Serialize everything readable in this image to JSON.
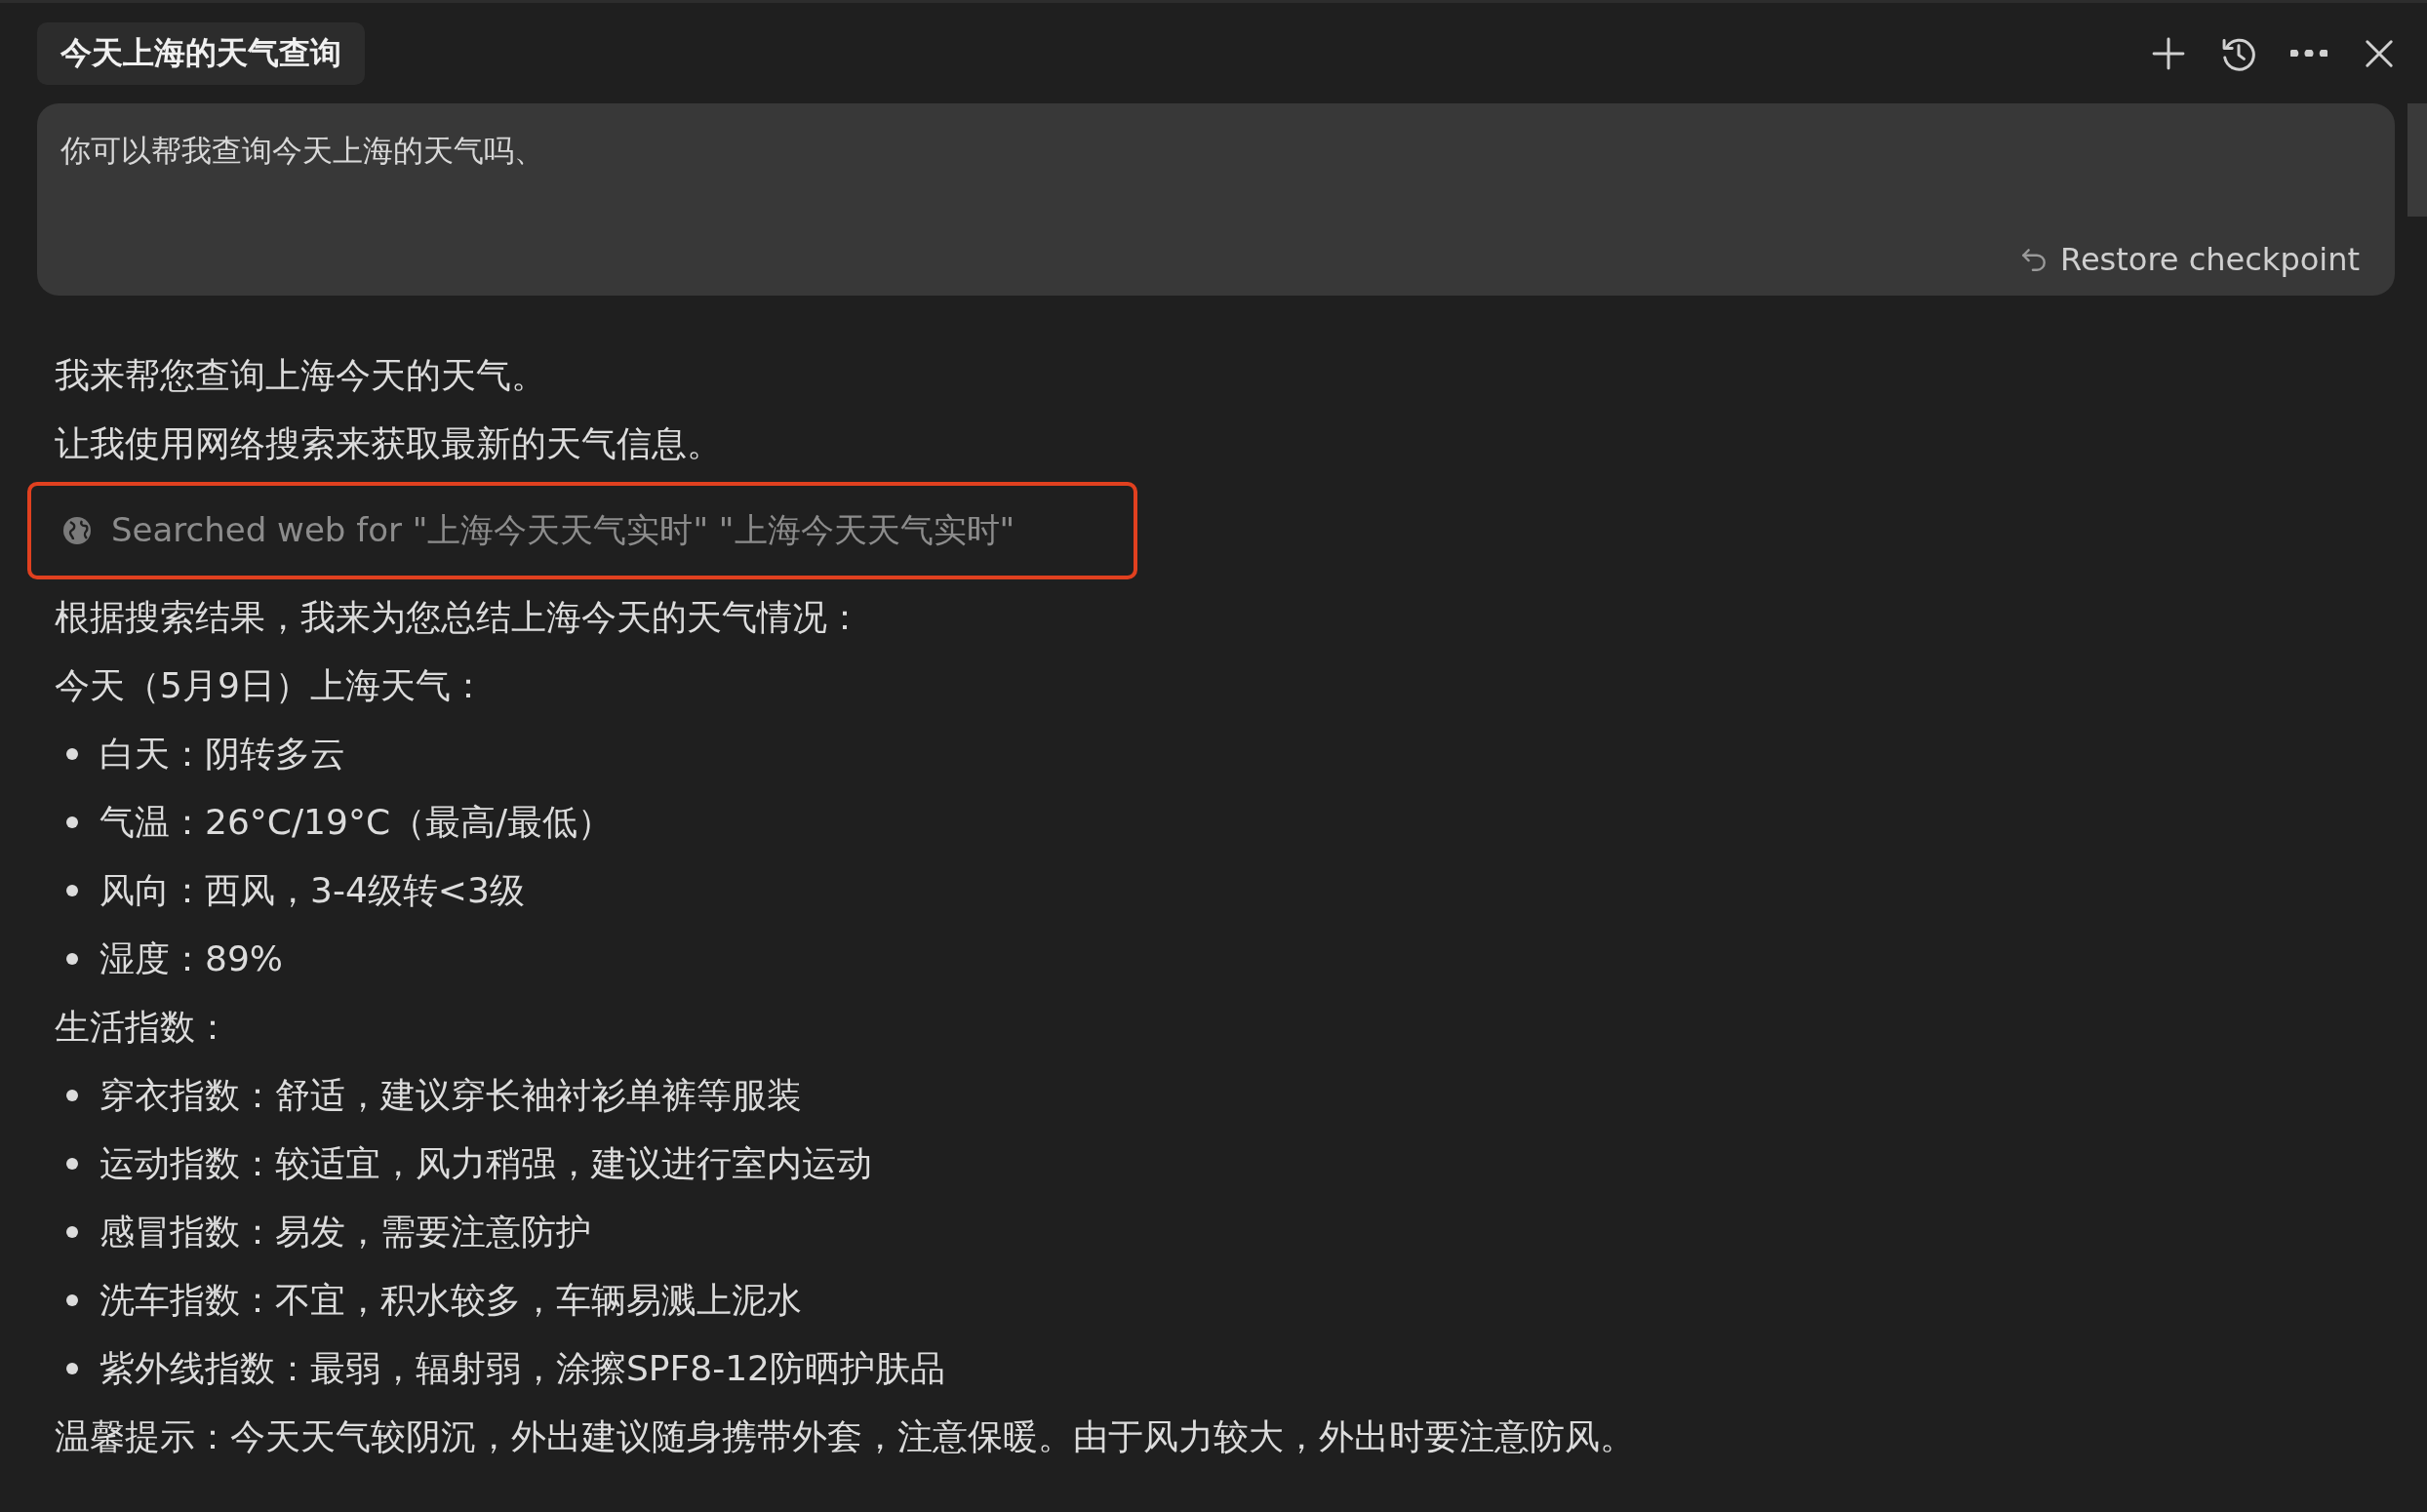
{
  "tab": {
    "title": "今天上海的天气查询"
  },
  "toolbar": [
    {
      "kind": "plus"
    },
    {
      "kind": "history"
    },
    {
      "kind": "more"
    },
    {
      "kind": "close"
    }
  ],
  "user_message": {
    "text": "你可以帮我查询今天上海的天气吗、",
    "restore": "Restore checkpoint"
  },
  "blocks": [
    {
      "kind": "paragraph",
      "text": "我来帮您查询上海今天的天气。"
    },
    {
      "kind": "paragraph",
      "text": "让我使用网络搜索来获取最新的天气信息。"
    },
    {
      "kind": "search",
      "text": "Searched web for \"上海今天天气实时\" \"上海今天天气实时\"",
      "highlighted": true
    },
    {
      "kind": "paragraph",
      "text": "根据搜索结果，我来为您总结上海今天的天气情况："
    },
    {
      "kind": "paragraph",
      "text": "今天（5月9日）上海天气："
    },
    {
      "kind": "bullet",
      "text": "白天：阴转多云"
    },
    {
      "kind": "bullet",
      "text": "气温：26°C/19°C（最高/最低）"
    },
    {
      "kind": "bullet",
      "text": "风向：西风，3-4级转<3级"
    },
    {
      "kind": "bullet",
      "text": "湿度：89%"
    },
    {
      "kind": "paragraph",
      "text": "生活指数："
    },
    {
      "kind": "bullet",
      "text": "穿衣指数：舒适，建议穿长袖衬衫单裤等服装"
    },
    {
      "kind": "bullet",
      "text": "运动指数：较适宜，风力稍强，建议进行室内运动"
    },
    {
      "kind": "bullet",
      "text": "感冒指数：易发，需要注意防护"
    },
    {
      "kind": "bullet",
      "text": "洗车指数：不宜，积水较多，车辆易溅上泥水"
    },
    {
      "kind": "bullet",
      "text": "紫外线指数：最弱，辐射弱，涂擦SPF8-12防晒护肤品"
    },
    {
      "kind": "paragraph",
      "text": "温馨提示：今天天气较阴沉，外出建议随身携带外套，注意保暖。由于风力较大，外出时要注意防风。"
    }
  ]
}
